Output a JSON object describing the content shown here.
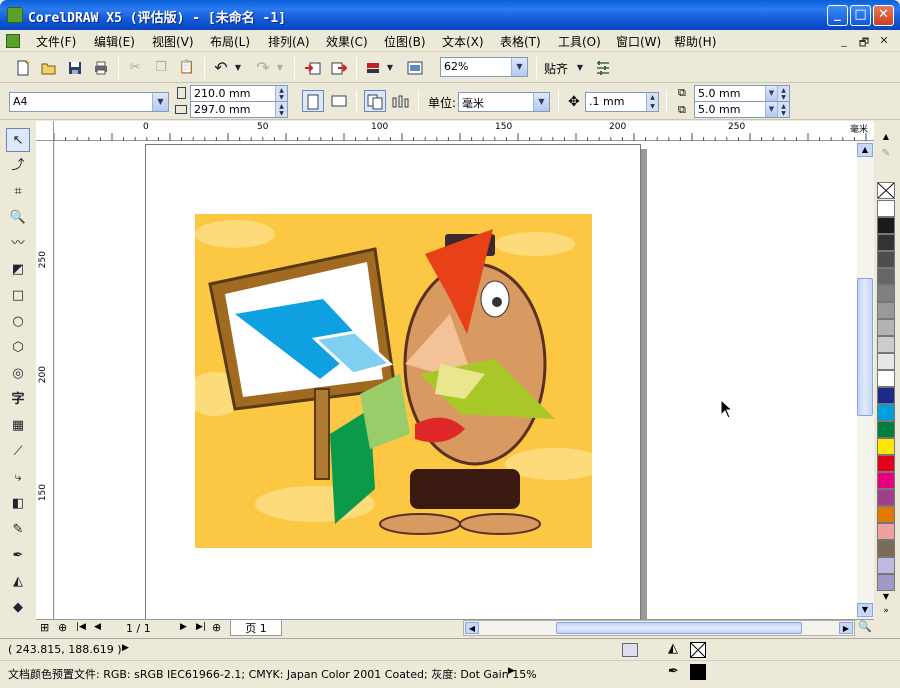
{
  "window": {
    "title": "CorelDRAW X5 (评估版) - [未命名 -1]",
    "minimize_icon": "_",
    "maximize_icon": "□",
    "close_icon": "✕"
  },
  "menu": {
    "items": [
      "文件(F)",
      "编辑(E)",
      "视图(V)",
      "布局(L)",
      "排列(A)",
      "效果(C)",
      "位图(B)",
      "文本(X)",
      "表格(T)",
      "工具(O)",
      "窗口(W)",
      "帮助(H)"
    ],
    "doc_minimize": "_",
    "doc_restore": "🗗",
    "doc_close": "✕"
  },
  "toolbar": {
    "zoom_value": "62%",
    "snap_label": "贴齐",
    "icons": [
      "new-icon",
      "open-icon",
      "save-icon",
      "print-icon",
      "cut-icon",
      "copy-icon",
      "paste-icon",
      "undo-icon",
      "redo-icon",
      "import-icon",
      "export-icon",
      "app-launcher-icon",
      "welcome-screen-icon",
      "options-icon"
    ]
  },
  "property_bar": {
    "page_size": "A4",
    "width": "210.0 mm",
    "height": "297.0 mm",
    "unit_label": "单位:",
    "unit_value": "毫米",
    "nudge_value": ".1 mm",
    "dup_x": "5.0 mm",
    "dup_y": "5.0 mm"
  },
  "ruler": {
    "top_labels": [
      "0",
      "50",
      "100",
      "150",
      "200",
      "250",
      "毫米"
    ],
    "left_labels": [
      "250",
      "200",
      "150"
    ]
  },
  "navigator": {
    "page_count": "1 / 1",
    "page_tab": "页 1"
  },
  "status": {
    "coordinates": "( 243.815, 188.619 )",
    "color_profile": "文档颜色预置文件: RGB: sRGB IEC61966-2.1; CMYK: Japan Color 2001 Coated; 灰度: Dot Gain 15%"
  },
  "palette_colors": [
    "#ffffff",
    "#1a1a1a",
    "#333333",
    "#4d4d4d",
    "#666666",
    "#808080",
    "#999999",
    "#b3b3b3",
    "#cccccc",
    "#e6e6e6",
    "#ffffff",
    "#1c2a8a",
    "#00a0e0",
    "#00803c",
    "#ffe600",
    "#e2001a",
    "#e5007f",
    "#a0408c",
    "#e07a00",
    "#f0a0a0",
    "#7a6a5a",
    "#c0b8e0",
    "#a098c8"
  ],
  "colors": {
    "art_background": "#fcc843",
    "logo_blue": "#0ea0e0",
    "logo_red": "#e84118",
    "logo_green": "#0a9a4a",
    "logo_yellowgreen": "#a8c828"
  }
}
